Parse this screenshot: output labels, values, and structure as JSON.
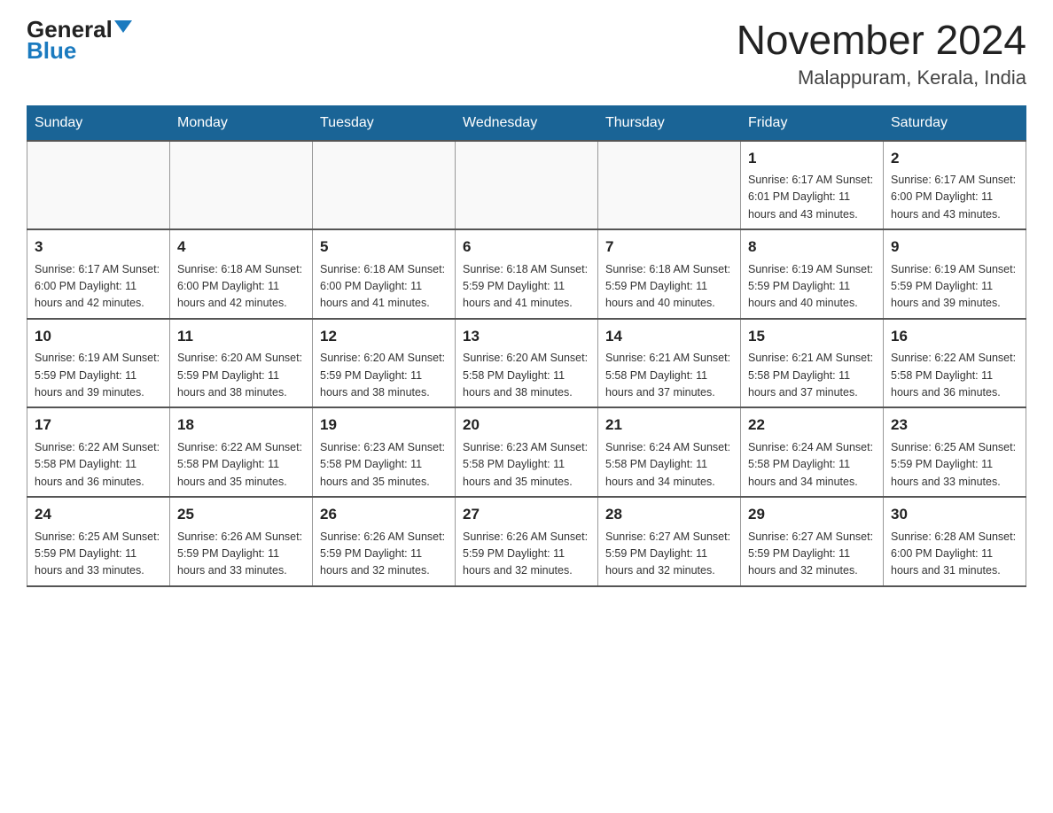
{
  "header": {
    "logo_general": "General",
    "logo_blue": "Blue",
    "title": "November 2024",
    "subtitle": "Malappuram, Kerala, India"
  },
  "weekdays": [
    "Sunday",
    "Monday",
    "Tuesday",
    "Wednesday",
    "Thursday",
    "Friday",
    "Saturday"
  ],
  "weeks": [
    [
      {
        "day": "",
        "info": ""
      },
      {
        "day": "",
        "info": ""
      },
      {
        "day": "",
        "info": ""
      },
      {
        "day": "",
        "info": ""
      },
      {
        "day": "",
        "info": ""
      },
      {
        "day": "1",
        "info": "Sunrise: 6:17 AM\nSunset: 6:01 PM\nDaylight: 11 hours\nand 43 minutes."
      },
      {
        "day": "2",
        "info": "Sunrise: 6:17 AM\nSunset: 6:00 PM\nDaylight: 11 hours\nand 43 minutes."
      }
    ],
    [
      {
        "day": "3",
        "info": "Sunrise: 6:17 AM\nSunset: 6:00 PM\nDaylight: 11 hours\nand 42 minutes."
      },
      {
        "day": "4",
        "info": "Sunrise: 6:18 AM\nSunset: 6:00 PM\nDaylight: 11 hours\nand 42 minutes."
      },
      {
        "day": "5",
        "info": "Sunrise: 6:18 AM\nSunset: 6:00 PM\nDaylight: 11 hours\nand 41 minutes."
      },
      {
        "day": "6",
        "info": "Sunrise: 6:18 AM\nSunset: 5:59 PM\nDaylight: 11 hours\nand 41 minutes."
      },
      {
        "day": "7",
        "info": "Sunrise: 6:18 AM\nSunset: 5:59 PM\nDaylight: 11 hours\nand 40 minutes."
      },
      {
        "day": "8",
        "info": "Sunrise: 6:19 AM\nSunset: 5:59 PM\nDaylight: 11 hours\nand 40 minutes."
      },
      {
        "day": "9",
        "info": "Sunrise: 6:19 AM\nSunset: 5:59 PM\nDaylight: 11 hours\nand 39 minutes."
      }
    ],
    [
      {
        "day": "10",
        "info": "Sunrise: 6:19 AM\nSunset: 5:59 PM\nDaylight: 11 hours\nand 39 minutes."
      },
      {
        "day": "11",
        "info": "Sunrise: 6:20 AM\nSunset: 5:59 PM\nDaylight: 11 hours\nand 38 minutes."
      },
      {
        "day": "12",
        "info": "Sunrise: 6:20 AM\nSunset: 5:59 PM\nDaylight: 11 hours\nand 38 minutes."
      },
      {
        "day": "13",
        "info": "Sunrise: 6:20 AM\nSunset: 5:58 PM\nDaylight: 11 hours\nand 38 minutes."
      },
      {
        "day": "14",
        "info": "Sunrise: 6:21 AM\nSunset: 5:58 PM\nDaylight: 11 hours\nand 37 minutes."
      },
      {
        "day": "15",
        "info": "Sunrise: 6:21 AM\nSunset: 5:58 PM\nDaylight: 11 hours\nand 37 minutes."
      },
      {
        "day": "16",
        "info": "Sunrise: 6:22 AM\nSunset: 5:58 PM\nDaylight: 11 hours\nand 36 minutes."
      }
    ],
    [
      {
        "day": "17",
        "info": "Sunrise: 6:22 AM\nSunset: 5:58 PM\nDaylight: 11 hours\nand 36 minutes."
      },
      {
        "day": "18",
        "info": "Sunrise: 6:22 AM\nSunset: 5:58 PM\nDaylight: 11 hours\nand 35 minutes."
      },
      {
        "day": "19",
        "info": "Sunrise: 6:23 AM\nSunset: 5:58 PM\nDaylight: 11 hours\nand 35 minutes."
      },
      {
        "day": "20",
        "info": "Sunrise: 6:23 AM\nSunset: 5:58 PM\nDaylight: 11 hours\nand 35 minutes."
      },
      {
        "day": "21",
        "info": "Sunrise: 6:24 AM\nSunset: 5:58 PM\nDaylight: 11 hours\nand 34 minutes."
      },
      {
        "day": "22",
        "info": "Sunrise: 6:24 AM\nSunset: 5:58 PM\nDaylight: 11 hours\nand 34 minutes."
      },
      {
        "day": "23",
        "info": "Sunrise: 6:25 AM\nSunset: 5:59 PM\nDaylight: 11 hours\nand 33 minutes."
      }
    ],
    [
      {
        "day": "24",
        "info": "Sunrise: 6:25 AM\nSunset: 5:59 PM\nDaylight: 11 hours\nand 33 minutes."
      },
      {
        "day": "25",
        "info": "Sunrise: 6:26 AM\nSunset: 5:59 PM\nDaylight: 11 hours\nand 33 minutes."
      },
      {
        "day": "26",
        "info": "Sunrise: 6:26 AM\nSunset: 5:59 PM\nDaylight: 11 hours\nand 32 minutes."
      },
      {
        "day": "27",
        "info": "Sunrise: 6:26 AM\nSunset: 5:59 PM\nDaylight: 11 hours\nand 32 minutes."
      },
      {
        "day": "28",
        "info": "Sunrise: 6:27 AM\nSunset: 5:59 PM\nDaylight: 11 hours\nand 32 minutes."
      },
      {
        "day": "29",
        "info": "Sunrise: 6:27 AM\nSunset: 5:59 PM\nDaylight: 11 hours\nand 32 minutes."
      },
      {
        "day": "30",
        "info": "Sunrise: 6:28 AM\nSunset: 6:00 PM\nDaylight: 11 hours\nand 31 minutes."
      }
    ]
  ]
}
